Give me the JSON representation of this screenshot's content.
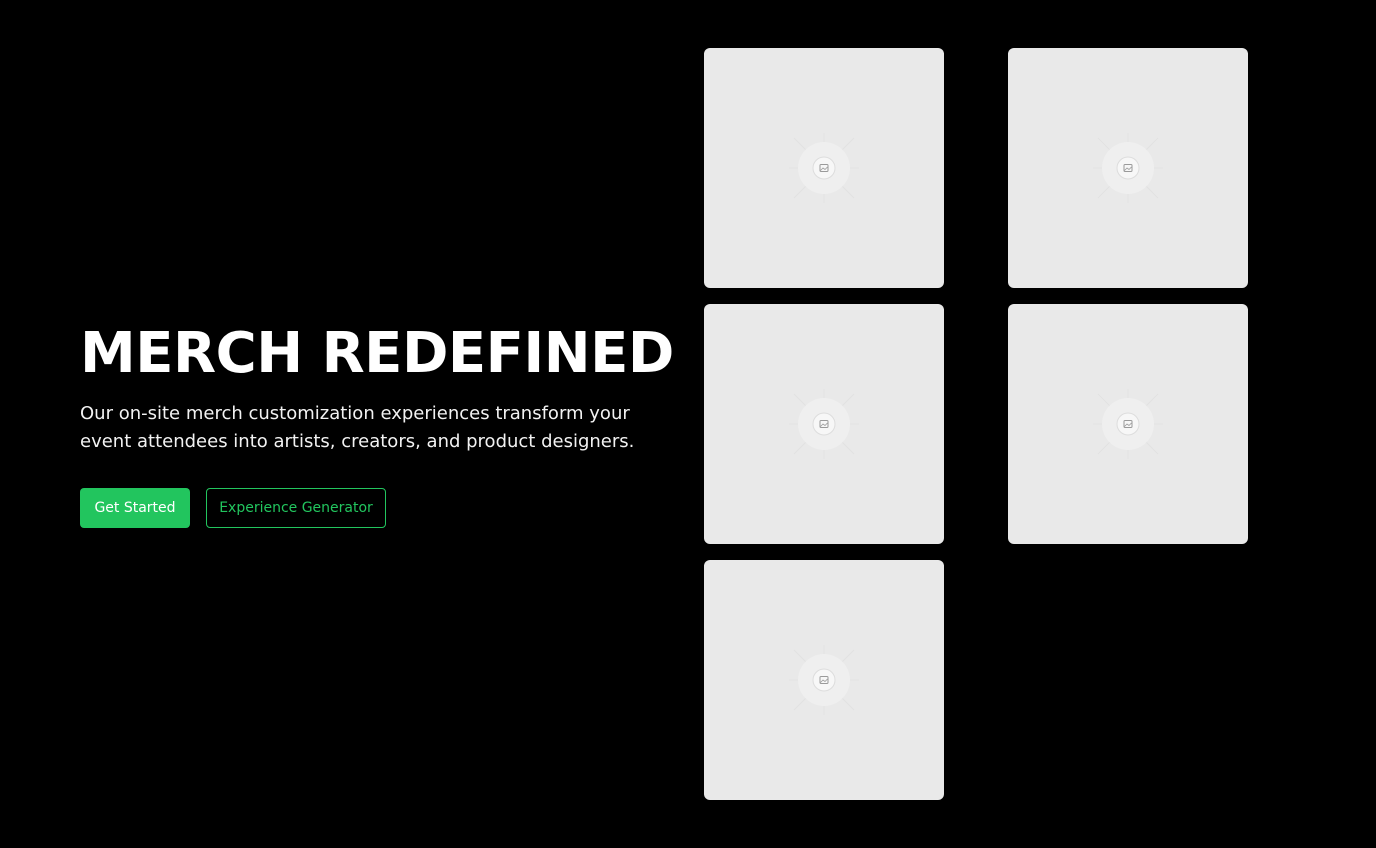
{
  "hero": {
    "title": "MERCH REDEFINED",
    "subtitle": "Our on-site merch customization experiences transform your event attendees into artists, creators, and product designers.",
    "primary_button": "Get Started",
    "secondary_button": "Experience Generator"
  },
  "colors": {
    "background": "#000000",
    "accent": "#22c55e",
    "tile": "#e9e9e9"
  },
  "gallery": {
    "tiles": [
      {
        "icon": "image-placeholder-icon"
      },
      {
        "icon": "image-placeholder-icon"
      },
      {
        "icon": "image-placeholder-icon"
      },
      {
        "icon": "image-placeholder-icon"
      },
      {
        "icon": "image-placeholder-icon"
      }
    ]
  }
}
